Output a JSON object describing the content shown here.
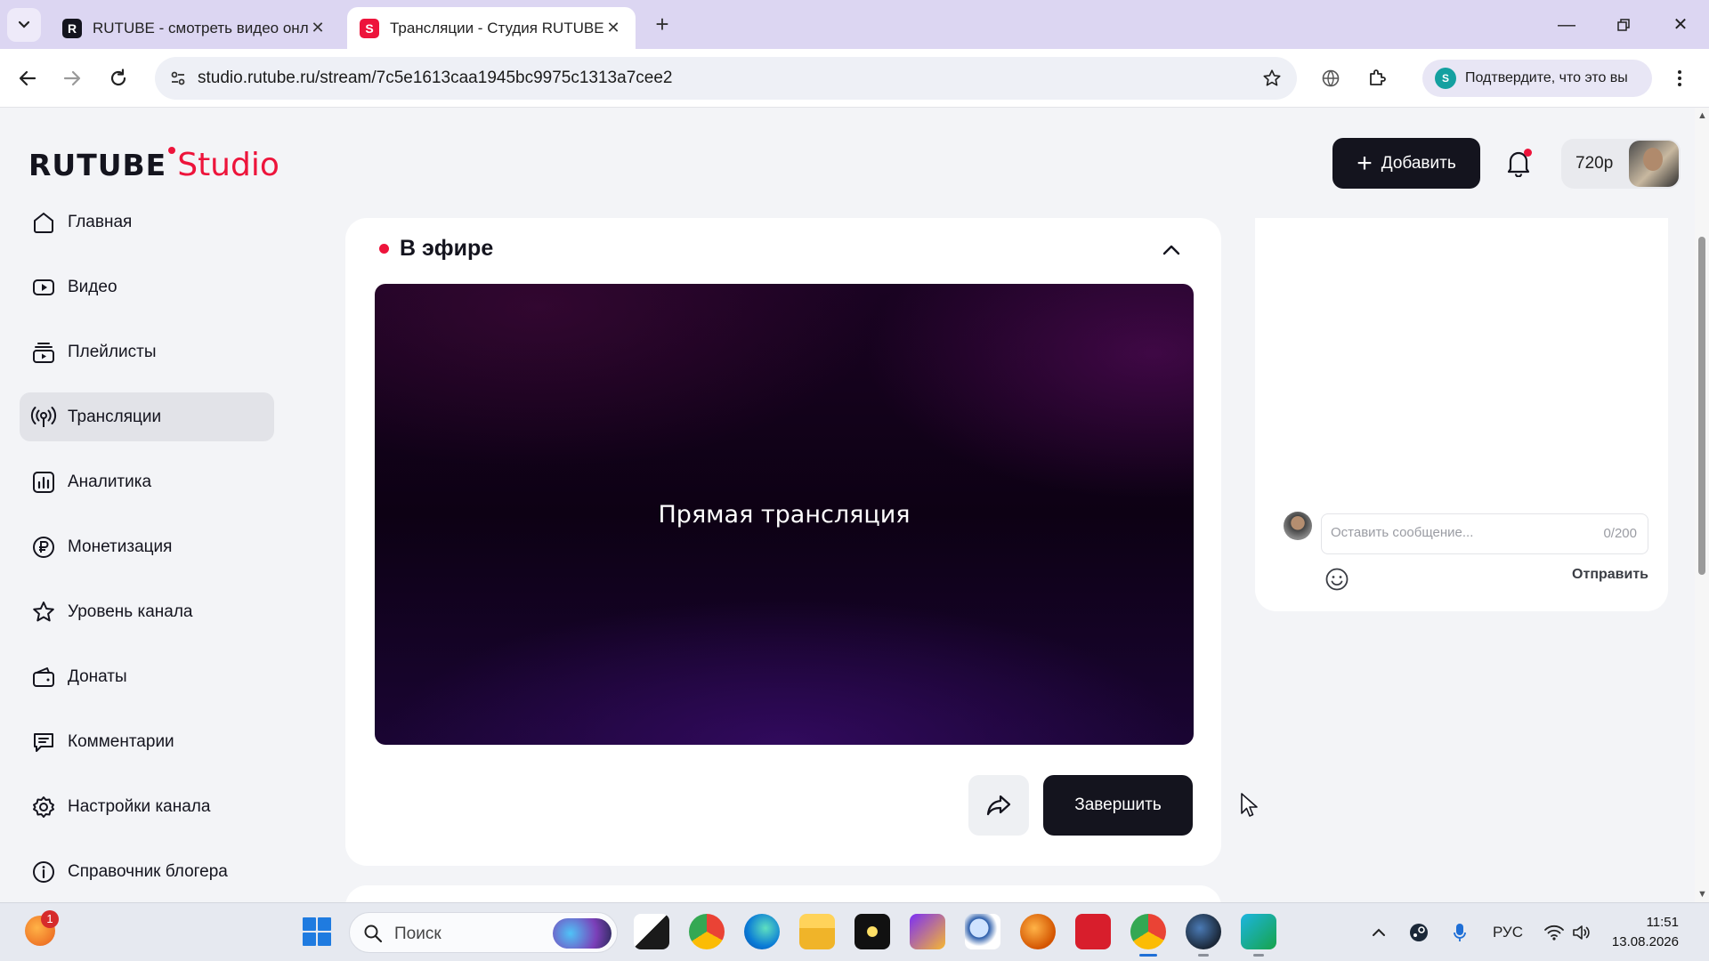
{
  "browser": {
    "tabs": [
      {
        "title": "RUTUBE - смотреть видео онлайн",
        "favicon": "rutube-r-icon",
        "active": false
      },
      {
        "title": "Трансляции - Студия RUTUBE",
        "favicon": "rutube-studio-icon",
        "active": true
      }
    ],
    "url": "studio.rutube.ru/stream/7c5e1613caa1945bc9975c1313a7cee2",
    "verify_label": "Подтвердите, что это вы"
  },
  "header": {
    "logo_main": "RUTUBE",
    "logo_accent": "Studio",
    "add_button": "Добавить",
    "quality": "720p"
  },
  "sidebar": {
    "items": [
      {
        "label": "Главная",
        "icon": "home-icon",
        "active": false
      },
      {
        "label": "Видео",
        "icon": "video-icon",
        "active": false
      },
      {
        "label": "Плейлисты",
        "icon": "playlists-icon",
        "active": false
      },
      {
        "label": "Трансляции",
        "icon": "broadcast-icon",
        "active": true
      },
      {
        "label": "Аналитика",
        "icon": "analytics-icon",
        "active": false
      },
      {
        "label": "Монетизация",
        "icon": "ruble-icon",
        "active": false
      },
      {
        "label": "Уровень канала",
        "icon": "star-icon",
        "active": false
      },
      {
        "label": "Донаты",
        "icon": "wallet-icon",
        "active": false
      },
      {
        "label": "Комментарии",
        "icon": "comment-icon",
        "active": false
      },
      {
        "label": "Настройки канала",
        "icon": "gear-icon",
        "active": false
      },
      {
        "label": "Справочник блогера",
        "icon": "info-icon",
        "active": false
      }
    ]
  },
  "stream": {
    "status_label": "В эфире",
    "player_label": "Прямая трансляция",
    "finish_button": "Завершить"
  },
  "chat": {
    "placeholder": "Оставить сообщение...",
    "counter": "0/200",
    "send_label": "Отправить"
  },
  "taskbar": {
    "search_label": "Поиск",
    "notification_count": "1",
    "language": "РУС",
    "time": "11:51",
    "date": "13.08.2026"
  },
  "colors": {
    "accent": "#ed143b",
    "dark": "#14141e",
    "tabbar": "#dcd6f2"
  }
}
